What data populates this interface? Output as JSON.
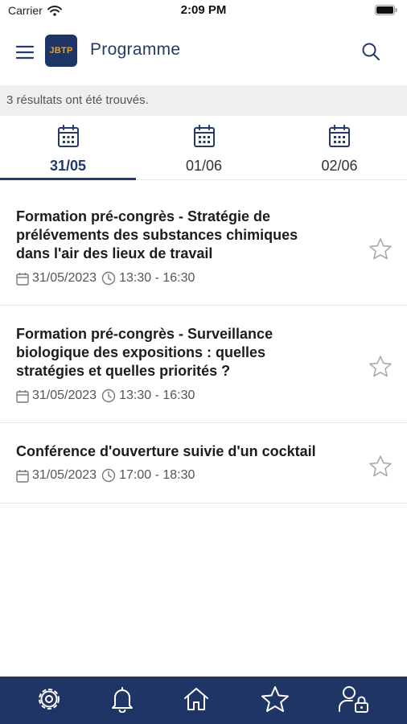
{
  "status_bar": {
    "carrier": "Carrier",
    "time": "2:09 PM"
  },
  "header": {
    "logo_text": "JBTP",
    "title": "Programme"
  },
  "results": {
    "text": "3 résultats ont été trouvés."
  },
  "date_tabs": [
    {
      "label": "31/05",
      "active": true
    },
    {
      "label": "01/06",
      "active": false
    },
    {
      "label": "02/06",
      "active": false
    }
  ],
  "events": [
    {
      "title_lines": [
        "Formation pré-congrès - Stratégie de",
        "prélévements des substances chimiques",
        "dans l'air des lieux de travail"
      ],
      "date": "31/05/2023",
      "time": "13:30 - 16:30"
    },
    {
      "title_lines": [
        "Formation pré-congrès - Surveillance",
        "biologique des expositions : quelles",
        "stratégies et quelles priorités ?"
      ],
      "date": "31/05/2023",
      "time": "13:30 - 16:30"
    },
    {
      "title_lines": [
        "Conférence d'ouverture suivie d'un cocktail"
      ],
      "date": "31/05/2023",
      "time": "17:00 - 18:30"
    }
  ],
  "bottom_nav": [
    "gear-icon",
    "bell-icon",
    "home-icon",
    "star-icon",
    "user-lock-icon"
  ],
  "colors": {
    "brand": "#1f3566",
    "accent": "#f0a020",
    "results_bg": "#efefef"
  }
}
